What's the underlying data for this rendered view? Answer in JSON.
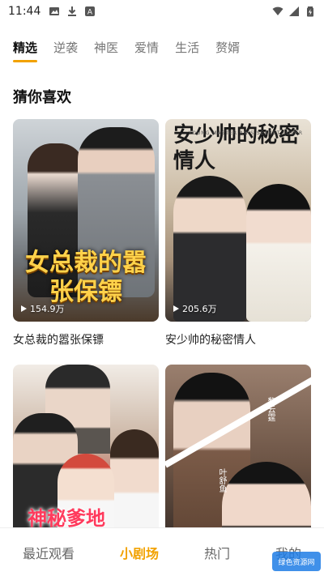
{
  "status_bar": {
    "time": "11:44"
  },
  "tabs": [
    {
      "label": "精选",
      "active": true
    },
    {
      "label": "逆袭",
      "active": false
    },
    {
      "label": "神医",
      "active": false
    },
    {
      "label": "爱情",
      "active": false
    },
    {
      "label": "生活",
      "active": false
    },
    {
      "label": "赘婿",
      "active": false
    }
  ],
  "section": {
    "title": "猜你喜欢"
  },
  "cards": [
    {
      "poster_title": "女总裁的嚣张保镖",
      "views": "154.9万",
      "caption": "女总裁的嚣张保镖"
    },
    {
      "poster_title": "安少帅的秘密情人",
      "poster_subtitle": "YOUNG MASTER AN'S SECRET LOVER",
      "views": "205.6万",
      "caption": "安少帅的秘密情人"
    },
    {
      "poster_title": "神秘爹地"
    },
    {
      "tag_a": "叶舒鱼",
      "tag_b": "黎云霆"
    }
  ],
  "bottom_nav": [
    {
      "label": "最近观看",
      "active": false
    },
    {
      "label": "小剧场",
      "active": true
    },
    {
      "label": "热门",
      "active": false
    },
    {
      "label": "我的",
      "active": false
    }
  ],
  "watermark": "绿色资源网",
  "colors": {
    "accent": "#f2a200"
  }
}
